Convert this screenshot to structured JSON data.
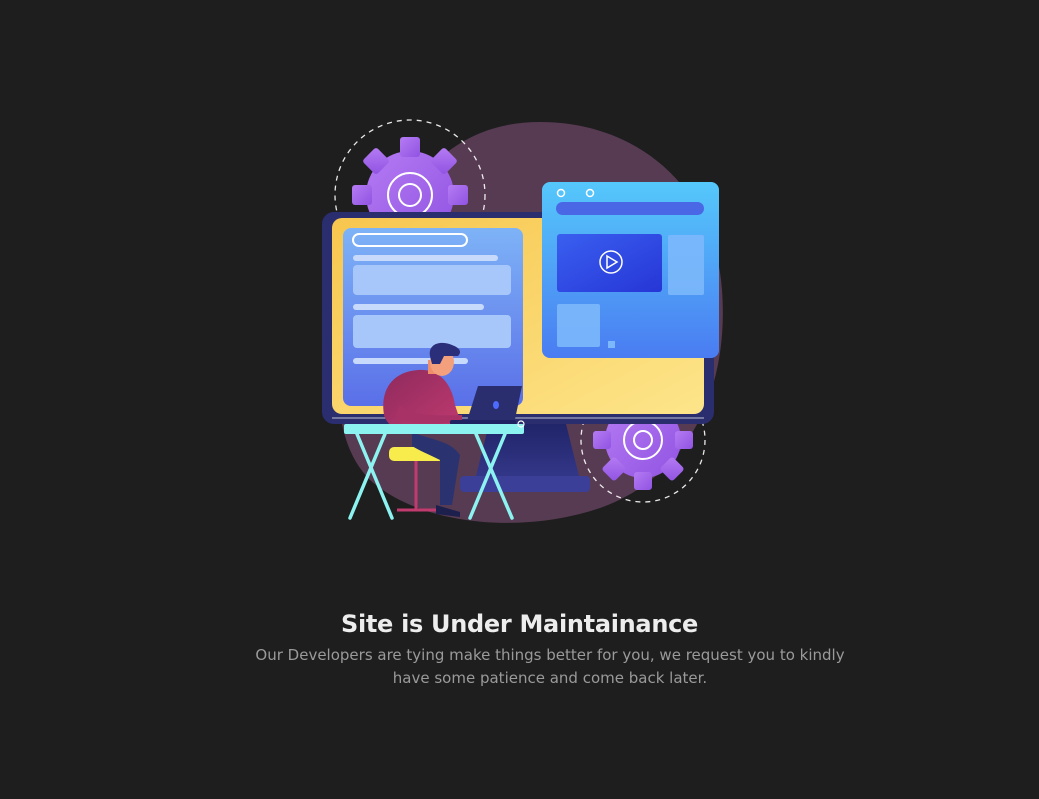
{
  "content": {
    "title": "Site is Under Maintainance",
    "message": "Our Developers are tying make things better for you, we request you to kindly have some patience and come back later."
  },
  "colors": {
    "background": "#1e1e1e",
    "title": "#ededed",
    "message": "#9a9a9a",
    "blob": "#5b3d55",
    "gear": "#a76ee8",
    "monitor_frame": "#2a2e6e",
    "monitor_screen": "#f5d46a",
    "window_blue": "#4aa3f5"
  },
  "icons": {
    "play": "play-icon",
    "gear": "gear-icon"
  }
}
